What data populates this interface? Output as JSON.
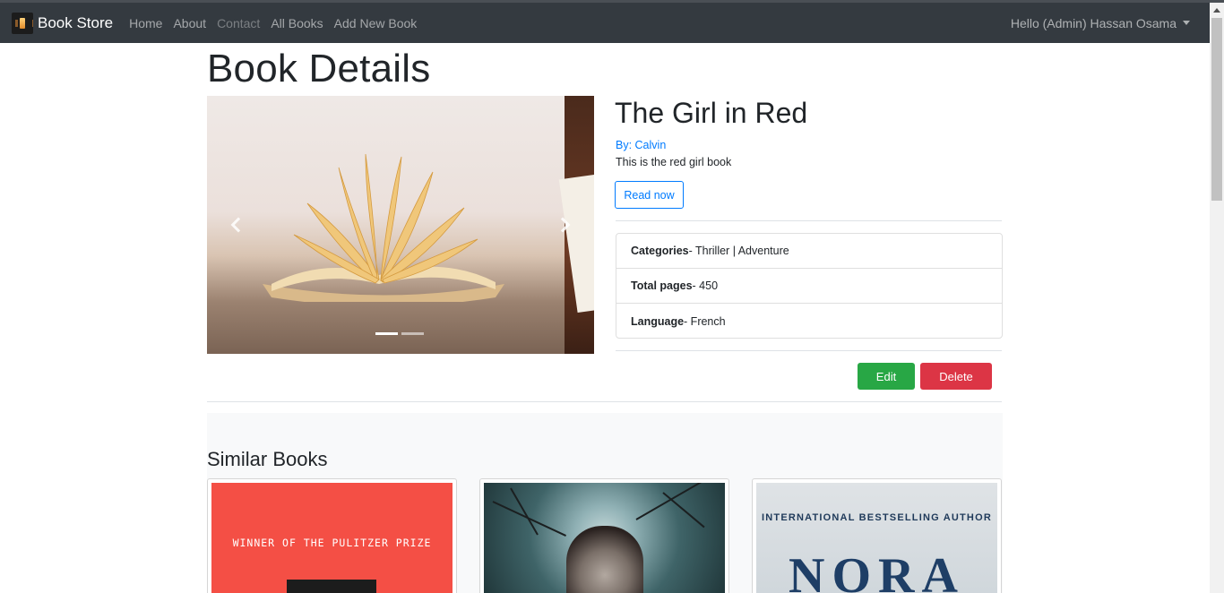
{
  "navbar": {
    "brand": "Book Store",
    "links": [
      "Home",
      "About",
      "Contact",
      "All Books",
      "Add New Book"
    ],
    "user": "Hello (Admin) Hassan Osama"
  },
  "page": {
    "title": "Book Details"
  },
  "book": {
    "title": "The Girl in Red",
    "author": "By: Calvin",
    "description": "This is the red girl book",
    "read_label": "Read now",
    "details": [
      {
        "label": "Categories",
        "value": " - Thriller | Adventure"
      },
      {
        "label": "Total pages",
        "value": " - 450"
      },
      {
        "label": "Language",
        "value": " - French"
      }
    ],
    "edit_label": "Edit",
    "delete_label": "Delete"
  },
  "carousel": {
    "slides": 2,
    "active_index": 0
  },
  "similar": {
    "title": "Similar Books",
    "cards": [
      {
        "cover_text": "WINNER OF THE PULITZER PRIZE"
      },
      {
        "cover_text": ""
      },
      {
        "cover_text": "INTERNATIONAL BESTSELLING AUTHOR",
        "cover_name": "NORA"
      }
    ]
  },
  "colors": {
    "navbar": "#343a40",
    "primary": "#007bff",
    "success": "#28a745",
    "danger": "#dc3545"
  }
}
